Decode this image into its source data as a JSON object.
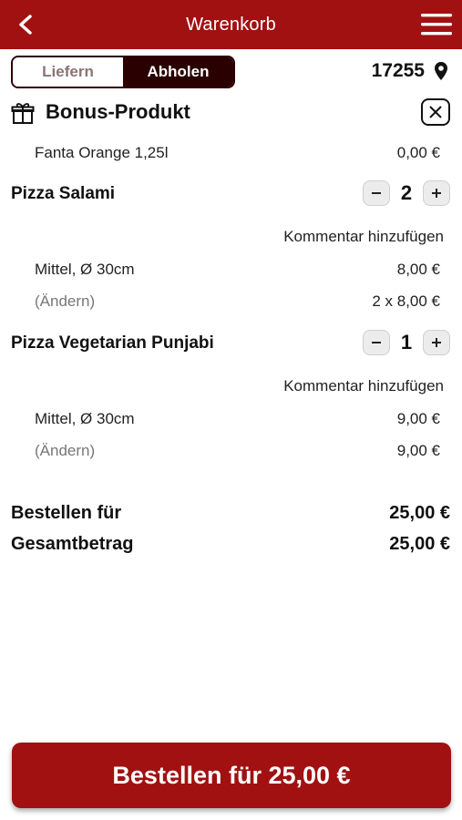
{
  "header": {
    "title": "Warenkorb",
    "back_icon": "chevron-left-icon",
    "menu_icon": "hamburger-menu-icon"
  },
  "toggle": {
    "deliver_label": "Liefern",
    "pickup_label": "Abholen",
    "selected": "Abholen"
  },
  "location": {
    "zip": "17255",
    "icon": "map-pin-icon"
  },
  "bonus": {
    "title": "Bonus-Produkt",
    "product": "Fanta Orange 1,25l",
    "price": "0,00 €"
  },
  "items": [
    {
      "name": "Pizza Salami",
      "quantity": "2",
      "comment_label": "Kommentar hinzufügen",
      "option": "Mittel, Ø 30cm",
      "option_price": "8,00 €",
      "change_label": "(Ändern)",
      "line_total": "2 x 8,00 €"
    },
    {
      "name": "Pizza Vegetarian Punjabi",
      "quantity": "1",
      "comment_label": "Kommentar hinzufügen",
      "option": "Mittel, Ø 30cm",
      "option_price": "9,00 €",
      "change_label": "(Ändern)",
      "line_total": "9,00 €"
    }
  ],
  "totals": {
    "order_for_label": "Bestellen für",
    "order_for_value": "25,00 €",
    "grand_total_label": "Gesamtbetrag",
    "grand_total_value": "25,00 €"
  },
  "order_button": {
    "label": "Bestellen für 25,00 €"
  },
  "colors": {
    "brand_red": "#a11111",
    "toggle_dark": "#2a0000"
  }
}
